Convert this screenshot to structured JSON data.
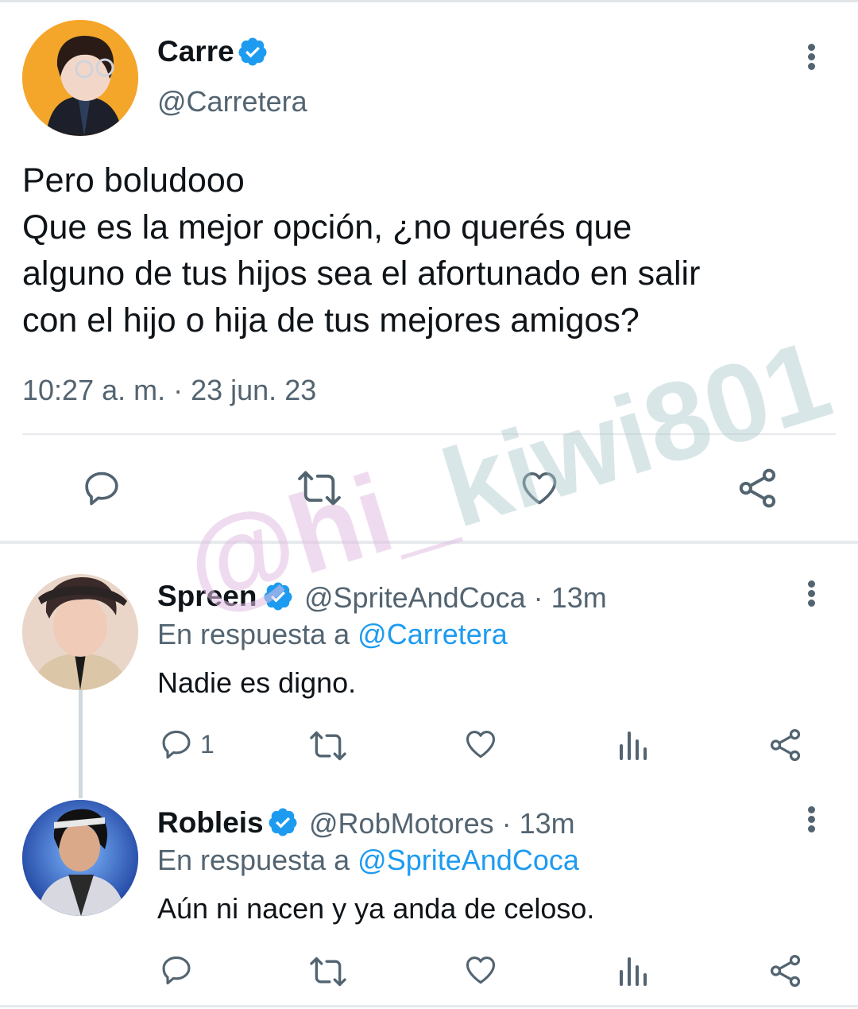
{
  "main_tweet": {
    "name": "Carre",
    "handle": "@Carretera",
    "text_lines": [
      "Pero boludooo",
      "Que es la mejor opción, ¿no querés que",
      "alguno de tus hijos sea el afortunado en salir",
      "con el hijo o hija de tus mejores amigos?"
    ],
    "timestamp": "10:27 a. m. · 23 jun. 23",
    "actions": [
      "reply-icon",
      "retweet-icon",
      "like-icon",
      "share-icon"
    ]
  },
  "replies": [
    {
      "name": "Spreen",
      "handle": "@SpriteAndCoca · 13m",
      "reply_prefix": "En respuesta a",
      "reply_mention": "@Carretera",
      "text": "Nadie es digno.",
      "reply_count": "1"
    },
    {
      "name": "Robleis",
      "handle": "@RobMotores · 13m",
      "reply_prefix": "En respuesta a",
      "reply_mention": "@SpriteAndCoca",
      "text": "Aún ni nacen y ya anda de celoso.",
      "reply_count": ""
    }
  ],
  "watermark": {
    "part1": "@hi_",
    "part2": "kiwi801"
  },
  "colors": {
    "text": "#0f1419",
    "secondary": "#536471",
    "link": "#1d9bf0",
    "verified": "#1d9bf0",
    "divider": "#e7eaed"
  }
}
